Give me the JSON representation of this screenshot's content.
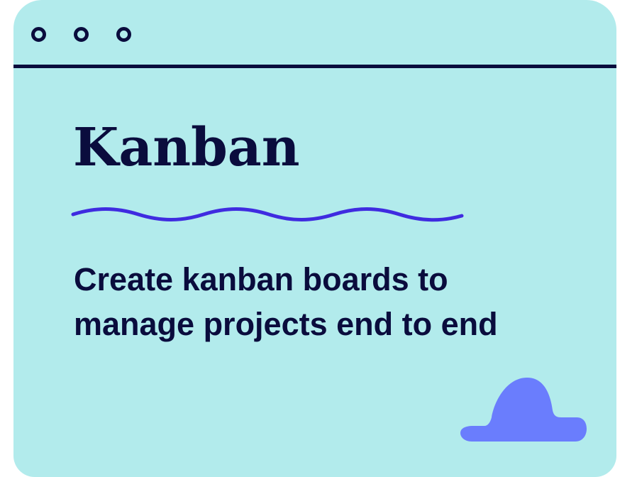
{
  "window": {
    "controls": [
      "window-dot",
      "window-dot",
      "window-dot"
    ]
  },
  "card": {
    "title": "Kanban",
    "subtitle_lines": [
      "Create kanban boards to",
      "manage projects end to end"
    ]
  },
  "colors": {
    "background": "#b2ebec",
    "text": "#0a0c3d",
    "wave": "#3f2be0",
    "blob": "#6a7dfd"
  }
}
